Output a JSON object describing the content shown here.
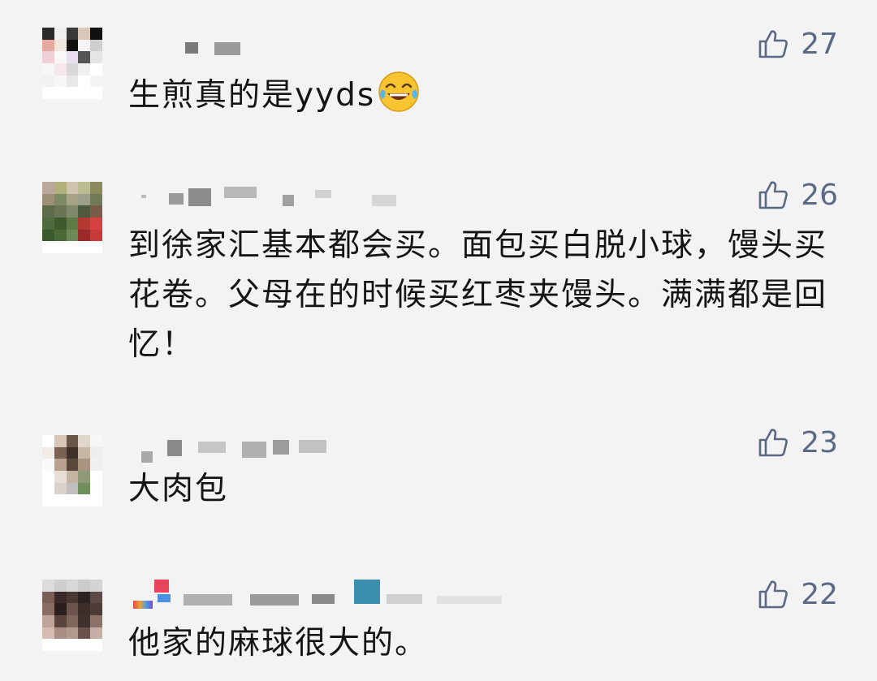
{
  "comments": [
    {
      "likes": "27",
      "text": "生煎真的是yyds",
      "emoji": "tears-of-joy-emoji",
      "avatar_colors": [
        "#2b2b2b",
        "#efefef",
        "#3a3a3a",
        "#d9c8b8",
        "#111111",
        "#e6a9a0",
        "#f2e6dc",
        "#111111",
        "#f4f4f4",
        "#cfcfcf",
        "#f0d0d6",
        "#f8f8f8",
        "#e9dff0",
        "#555555",
        "#e5e5e5",
        "#f6f6f6",
        "#f5e7ec",
        "#d8d8d8",
        "#f0f0f0",
        "#ffffff",
        "#f2f2f2",
        "#f7f7f7",
        "#e8e8e8",
        "#ffffff",
        "#f4f4f4",
        "#ffffff",
        "#ffffff",
        "#ffffff",
        "#ffffff",
        "#ffffff"
      ]
    },
    {
      "likes": "26",
      "text": "到徐家汇基本都会买。面包买白脱小球，馒头买花卷。父母在的时候买红枣夹馒头。满满都是回忆！",
      "avatar_colors": [
        "#b9a89b",
        "#b2b07a",
        "#cfc4ad",
        "#b9bd8f",
        "#8a8a5d",
        "#9c8f77",
        "#7c8a66",
        "#a7a386",
        "#9ea189",
        "#6f7b59",
        "#5e6b4a",
        "#6a7553",
        "#7e8a6b",
        "#4e5a3e",
        "#7b5a4a",
        "#4d6b3c",
        "#3e5a2e",
        "#5e7a46",
        "#b23a32",
        "#d64040",
        "#3b5a2c",
        "#4a6a38",
        "#6b8a56",
        "#9a2a2a",
        "#c83a3a",
        "#ffffff",
        "#ffffff",
        "#ffffff",
        "#ffffff",
        "#ffffff"
      ]
    },
    {
      "likes": "23",
      "text": "大肉包",
      "avatar_colors": [
        "#ffffff",
        "#d7c7b8",
        "#6a5648",
        "#e0d6cc",
        "#f6f6f6",
        "#f1ece6",
        "#7a6252",
        "#3f3029",
        "#c8b6a4",
        "#eeeeee",
        "#fafafa",
        "#b8a28f",
        "#5a463b",
        "#a9957f",
        "#f0f0f0",
        "#ffffff",
        "#e6e0d8",
        "#c5b4a2",
        "#8e9a78",
        "#ffffff",
        "#ffffff",
        "#d8d2ca",
        "#bfbfbf",
        "#6f8f5a",
        "#ffffff",
        "#ffffff",
        "#ffffff",
        "#ffffff",
        "#ffffff",
        "#ffffff"
      ]
    },
    {
      "likes": "22",
      "text": "他家的麻球很大的。",
      "avatar_colors": [
        "#dcdcdc",
        "#cfcfcf",
        "#d8d8d8",
        "#cccccc",
        "#d4d4d4",
        "#7a5f56",
        "#3a2b28",
        "#4a3833",
        "#2d2220",
        "#5e4a44",
        "#8a6c60",
        "#2a1f1d",
        "#6e554c",
        "#3b2d2a",
        "#4d3b36",
        "#c0a49a",
        "#5a443d",
        "#7f665c",
        "#3f302c",
        "#8d7268",
        "#d4bcb2",
        "#a88e84",
        "#b39a8f",
        "#6a524a",
        "#c6aea4",
        "#ffffff",
        "#ffffff",
        "#ffffff",
        "#ffffff",
        "#ffffff"
      ]
    }
  ],
  "colors": {
    "background": "#f3f3f3",
    "like_color": "#5a6a86",
    "text_color": "#151515"
  }
}
